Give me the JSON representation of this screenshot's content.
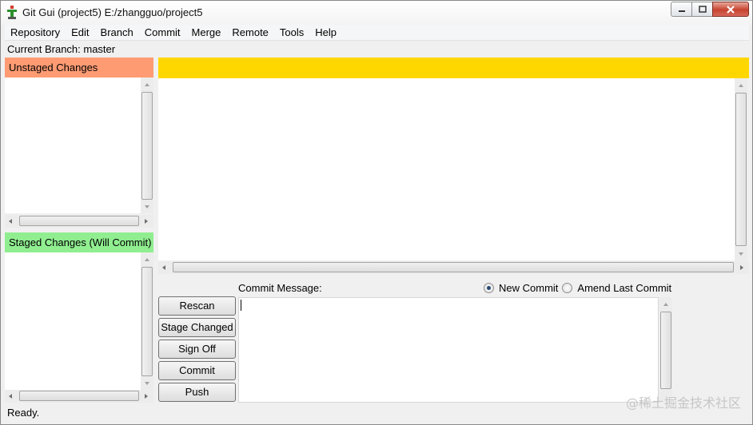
{
  "window": {
    "title": "Git Gui (project5) E:/zhangguo/project5",
    "icon": "git-app-icon"
  },
  "menu": {
    "items": [
      "Repository",
      "Edit",
      "Branch",
      "Commit",
      "Merge",
      "Remote",
      "Tools",
      "Help"
    ]
  },
  "branch": {
    "label": "Current Branch: master"
  },
  "unstaged": {
    "header": "Unstaged Changes",
    "color": "#ff9b73"
  },
  "staged": {
    "header": "Staged Changes (Will Commit)",
    "color": "#90ee90"
  },
  "diff": {
    "header_color": "#ffd700"
  },
  "commit": {
    "message_label": "Commit Message:",
    "options": [
      {
        "label": "New Commit",
        "checked": true
      },
      {
        "label": "Amend Last Commit",
        "checked": false
      }
    ],
    "buttons": [
      "Rescan",
      "Stage Changed",
      "Sign Off",
      "Commit",
      "Push"
    ]
  },
  "status": {
    "text": "Ready."
  },
  "watermark": "@稀土掘金技术社区"
}
